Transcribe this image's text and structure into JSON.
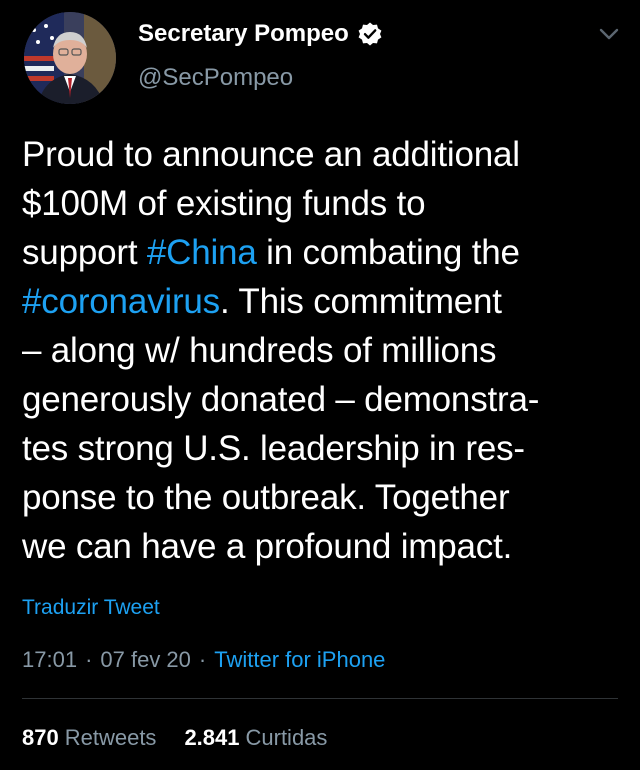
{
  "author": {
    "display_name": "Secretary Pompeo",
    "handle": "@SecPompeo",
    "verified": true
  },
  "tweet": {
    "lines": [
      [
        {
          "text": "Proud to announce an additional",
          "type": "text"
        }
      ],
      [
        {
          "text": "$100M of existing funds to",
          "type": "text"
        }
      ],
      [
        {
          "text": "support ",
          "type": "text"
        },
        {
          "text": "#China",
          "type": "hashtag"
        },
        {
          "text": " in combating the",
          "type": "text"
        }
      ],
      [
        {
          "text": "#coronavirus",
          "type": "hashtag"
        },
        {
          "text": ". This commitment",
          "type": "text"
        }
      ],
      [
        {
          "text": "– along w/ hundreds of millions",
          "type": "text"
        }
      ],
      [
        {
          "text": "generously donated – demonstra-",
          "type": "text"
        }
      ],
      [
        {
          "text": "tes strong U.S. leadership in res-",
          "type": "text"
        }
      ],
      [
        {
          "text": "ponse to the outbreak. Together",
          "type": "text"
        }
      ],
      [
        {
          "text": "we can have a profound impact.",
          "type": "text"
        }
      ]
    ]
  },
  "translate_label": "Traduzir Tweet",
  "meta": {
    "time": "17:01",
    "separator": "·",
    "date": "07 fev 20",
    "source": "Twitter for iPhone"
  },
  "stats": {
    "retweets_count": "870",
    "retweets_label": "Retweets",
    "likes_count": "2.841",
    "likes_label": "Curtidas"
  },
  "icons": {
    "verified": "verified-badge-icon",
    "more": "chevron-down-icon"
  },
  "colors": {
    "background": "#000000",
    "accent": "#1da1f2",
    "secondary_text": "#8899a6"
  }
}
